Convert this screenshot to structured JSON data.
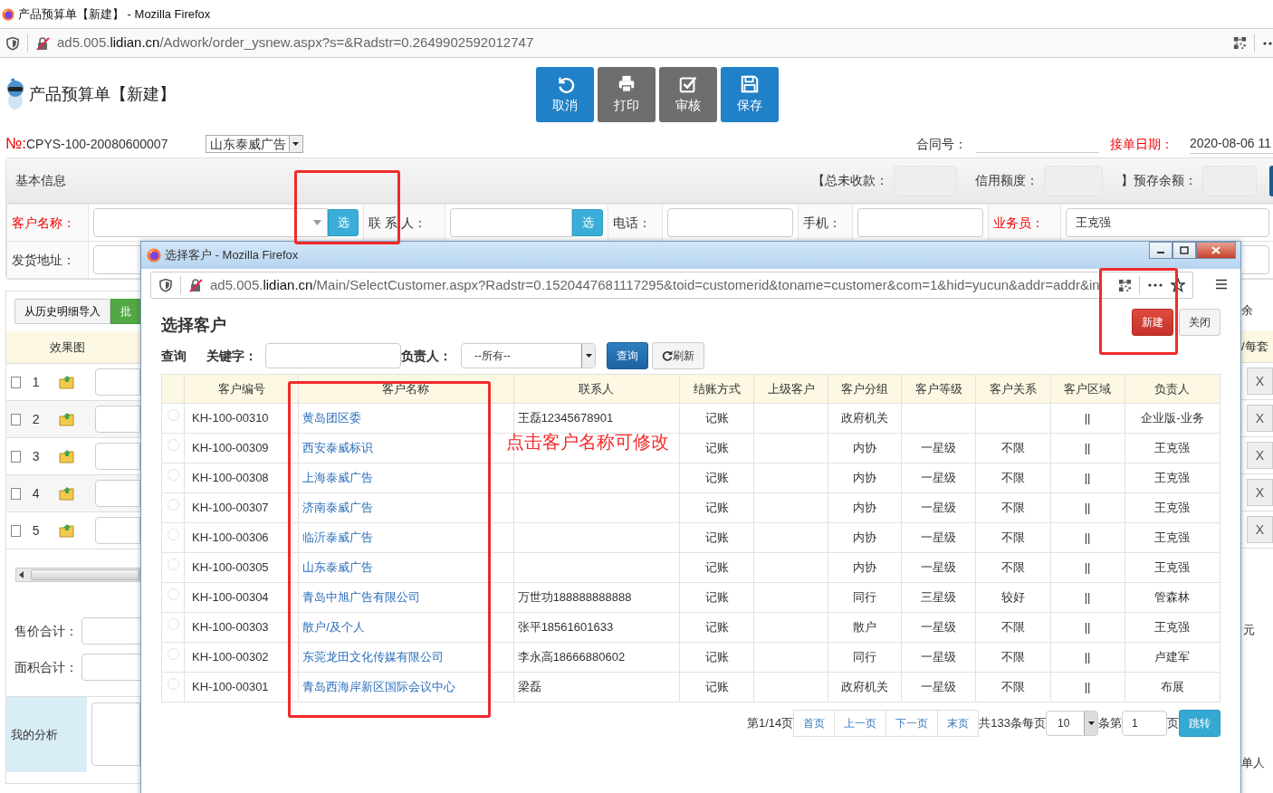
{
  "window": {
    "title": "产品预算单【新建】 - Mozilla Firefox",
    "url": {
      "host": "ad5.005.",
      "domain": "lidian.cn",
      "path": "/Adwork/order_ysnew.aspx?s=&Radstr=0.2649902592012747"
    }
  },
  "page": {
    "title": "产品预算单【新建】",
    "toolbar": [
      {
        "label": "取消",
        "color": "#2080c8"
      },
      {
        "label": "打印",
        "color": "#6e6e6e"
      },
      {
        "label": "审核",
        "color": "#6e6e6e"
      },
      {
        "label": "保存",
        "color": "#2080c8"
      }
    ],
    "number_label": "№:",
    "number": "CPYS-100-20080600007",
    "company": "山东泰威广告",
    "contract_label": "合同号：",
    "date_label": "接单日期：",
    "date": "2020-08-06 11"
  },
  "basic_info": {
    "title": "基本信息",
    "summary": [
      {
        "label": "【总未收款："
      },
      {
        "label": "信用额度："
      },
      {
        "label": "】预存余额："
      }
    ],
    "fields": [
      {
        "label": "客户名称：",
        "required": true,
        "kind": "combo",
        "pick_button": "选",
        "highlighted": true
      },
      {
        "label": "联 系 人：",
        "required": false,
        "kind": "pick",
        "pick_button": "选",
        "highlighted": false
      },
      {
        "label": "电话：",
        "required": false,
        "kind": "text",
        "highlighted": false
      },
      {
        "label": "手机：",
        "required": false,
        "kind": "text",
        "highlighted": false
      },
      {
        "label": "业务员：",
        "required": true,
        "kind": "text",
        "value": "王克强",
        "highlighted": false
      },
      {
        "label": "发货地址：",
        "required": false,
        "kind": "text",
        "highlighted": false
      }
    ]
  },
  "details": {
    "buttons": [
      "从历史明细导入",
      "批"
    ],
    "right_tabs": [
      "余"
    ],
    "column_header": "效果图",
    "right_column_header": "/每套",
    "rows": [
      {
        "number": "1",
        "checked": false,
        "remove": "X"
      },
      {
        "number": "2",
        "checked": false,
        "remove": "X"
      },
      {
        "number": "3",
        "checked": false,
        "remove": "X"
      },
      {
        "number": "4",
        "checked": false,
        "remove": "X"
      },
      {
        "number": "5",
        "checked": false,
        "remove": "X"
      }
    ],
    "totals": [
      {
        "label": "售价合计："
      },
      {
        "label": "面积合计："
      }
    ],
    "unit": "元",
    "analysis_label": "我的分析",
    "footer_fragment": "单人"
  },
  "popup": {
    "title": "选择客户 - Mozilla Firefox",
    "url": {
      "host": "ad5.005.",
      "domain": "lidian.cn",
      "path": "/Main/SelectCustomer.aspx?Radstr=0.1520447681117295&toid=customerid&toname=customer&com=1&hid=yucun&addr=addr&in"
    },
    "heading": "选择客户",
    "new_button": {
      "label": "新建",
      "highlighted": true
    },
    "close_button": "关闭",
    "search": {
      "label": "查询",
      "keyword_label": "关键字：",
      "owner_label": "负责人：",
      "owner_value": "--所有--",
      "search_button": "查询",
      "refresh_button": "刷新"
    },
    "columns": [
      {
        "label": "客户编号",
        "highlighted": false
      },
      {
        "label": "客户名称",
        "highlighted": true
      },
      {
        "label": "联系人",
        "highlighted": false
      },
      {
        "label": "结账方式",
        "highlighted": false
      },
      {
        "label": "上级客户",
        "highlighted": false
      },
      {
        "label": "客户分组",
        "highlighted": false
      },
      {
        "label": "客户等级",
        "highlighted": false
      },
      {
        "label": "客户关系",
        "highlighted": false
      },
      {
        "label": "客户区域",
        "highlighted": false
      },
      {
        "label": "负责人",
        "highlighted": false
      }
    ],
    "rows": [
      {
        "selected": false,
        "code": "KH-100-00310",
        "name": "黄岛团区委",
        "contact": "王磊12345678901",
        "settlement": "记账",
        "group": "政府机关",
        "region": "||",
        "owner": "企业版-业务"
      },
      {
        "selected": false,
        "code": "KH-100-00309",
        "name": "西安泰威标识",
        "settlement": "记账",
        "group": "内协",
        "level": "一星级",
        "relation": "不限",
        "region": "||",
        "owner": "王克强"
      },
      {
        "selected": false,
        "code": "KH-100-00308",
        "name": "上海泰威广告",
        "settlement": "记账",
        "group": "内协",
        "level": "一星级",
        "relation": "不限",
        "region": "||",
        "owner": "王克强"
      },
      {
        "selected": false,
        "code": "KH-100-00307",
        "name": "济南泰威广告",
        "settlement": "记账",
        "group": "内协",
        "level": "一星级",
        "relation": "不限",
        "region": "||",
        "owner": "王克强"
      },
      {
        "selected": false,
        "code": "KH-100-00306",
        "name": "临沂泰威广告",
        "settlement": "记账",
        "group": "内协",
        "level": "一星级",
        "relation": "不限",
        "region": "||",
        "owner": "王克强"
      },
      {
        "selected": false,
        "code": "KH-100-00305",
        "name": "山东泰威广告",
        "settlement": "记账",
        "group": "内协",
        "level": "一星级",
        "relation": "不限",
        "region": "||",
        "owner": "王克强"
      },
      {
        "selected": false,
        "code": "KH-100-00304",
        "name": "青岛中旭广告有限公司",
        "contact": "万世功188888888888",
        "settlement": "记账",
        "group": "同行",
        "level": "三星级",
        "relation": "较好",
        "region": "||",
        "owner": "管森林"
      },
      {
        "selected": false,
        "code": "KH-100-00303",
        "name": "散户/及个人",
        "contact": "张平18561601633",
        "settlement": "记账",
        "group": "散户",
        "level": "一星级",
        "relation": "不限",
        "region": "||",
        "owner": "王克强"
      },
      {
        "selected": false,
        "code": "KH-100-00302",
        "name": "东莞龙田文化传媒有限公司",
        "contact": "李永高18666880602",
        "settlement": "记账",
        "group": "同行",
        "level": "一星级",
        "relation": "不限",
        "region": "||",
        "owner": "卢建军"
      },
      {
        "selected": false,
        "code": "KH-100-00301",
        "name": "青岛西海岸新区国际会议中心",
        "contact": "梁磊",
        "settlement": "记账",
        "group": "政府机关",
        "level": "一星级",
        "relation": "不限",
        "region": "||",
        "owner": "布展"
      }
    ],
    "pager": {
      "status": "第1/14页",
      "links": [
        "首页",
        "上一页",
        "下一页",
        "末页"
      ],
      "total": "共133条每页",
      "page_size": "10",
      "before_page": "条第",
      "page": "1",
      "after_page": "页",
      "go_button": "跳转"
    },
    "note": "点击客户名称可修改"
  }
}
